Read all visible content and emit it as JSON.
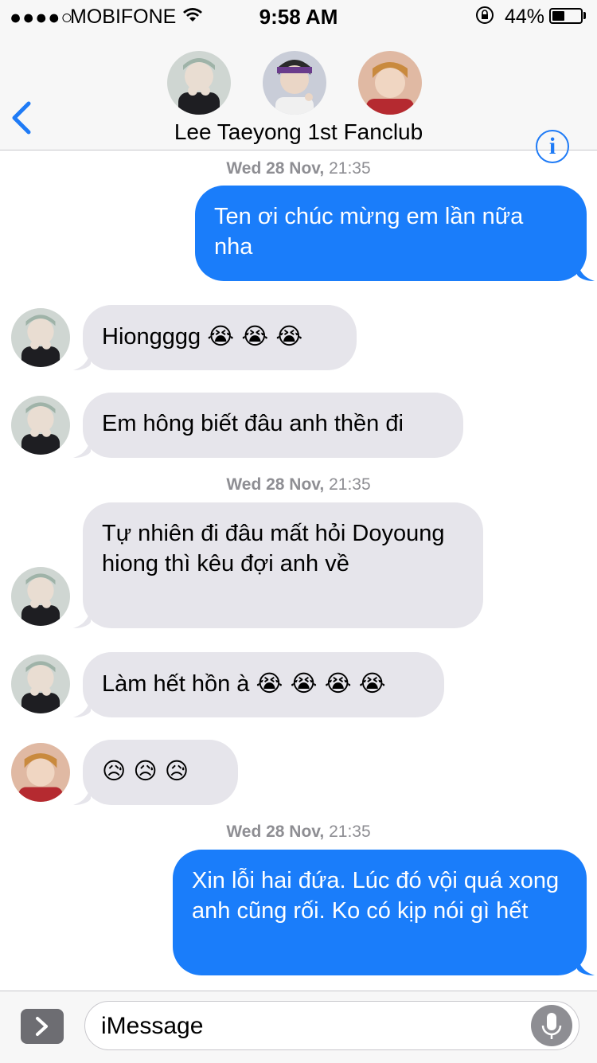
{
  "status_bar": {
    "signal": "●●●●○",
    "carrier": "MOBIFONE",
    "time": "9:58 AM",
    "battery_pct": "44%",
    "battery_level": 0.44
  },
  "header": {
    "title": "Lee Taeyong 1st Fanclub",
    "back_icon": "chevron-left-icon",
    "info_label": "i"
  },
  "messages": [
    {
      "type": "timestamp",
      "day": "Wed 28 Nov,",
      "time": "21:35"
    },
    {
      "type": "outgoing",
      "text": "Ten ơi chúc mừng em lần nữa nha"
    },
    {
      "type": "incoming",
      "sender": "avatar-1",
      "text": "Hiongggg",
      "emoji": "😭 😭 😭"
    },
    {
      "type": "incoming",
      "sender": "avatar-1",
      "text": "Em hông biết đâu anh thền đi"
    },
    {
      "type": "timestamp",
      "day": "Wed 28 Nov,",
      "time": "21:35"
    },
    {
      "type": "incoming",
      "sender": "avatar-1",
      "text": "Tự nhiên đi đâu mất hỏi Doyoung hiong thì kêu đợi anh về"
    },
    {
      "type": "incoming",
      "sender": "avatar-1",
      "text": "Làm hết hồn à",
      "emoji": "😭 😭 😭 😭"
    },
    {
      "type": "incoming",
      "sender": "avatar-3",
      "text": "",
      "emoji": "😥 😥 😥"
    },
    {
      "type": "timestamp",
      "day": "Wed 28 Nov,",
      "time": "21:35"
    },
    {
      "type": "outgoing",
      "text": "Xin lỗi hai đứa. Lúc đó vội quá xong anh cũng rối. Ko có kịp nói gì hết"
    }
  ],
  "composer": {
    "placeholder": "iMessage",
    "apps_icon": "chevron-right-icon",
    "mic_icon": "microphone-icon"
  },
  "colors": {
    "accent": "#1f7bf6",
    "outgoing_bubble": "#1a7dfa",
    "incoming_bubble": "#e6e5eb"
  }
}
